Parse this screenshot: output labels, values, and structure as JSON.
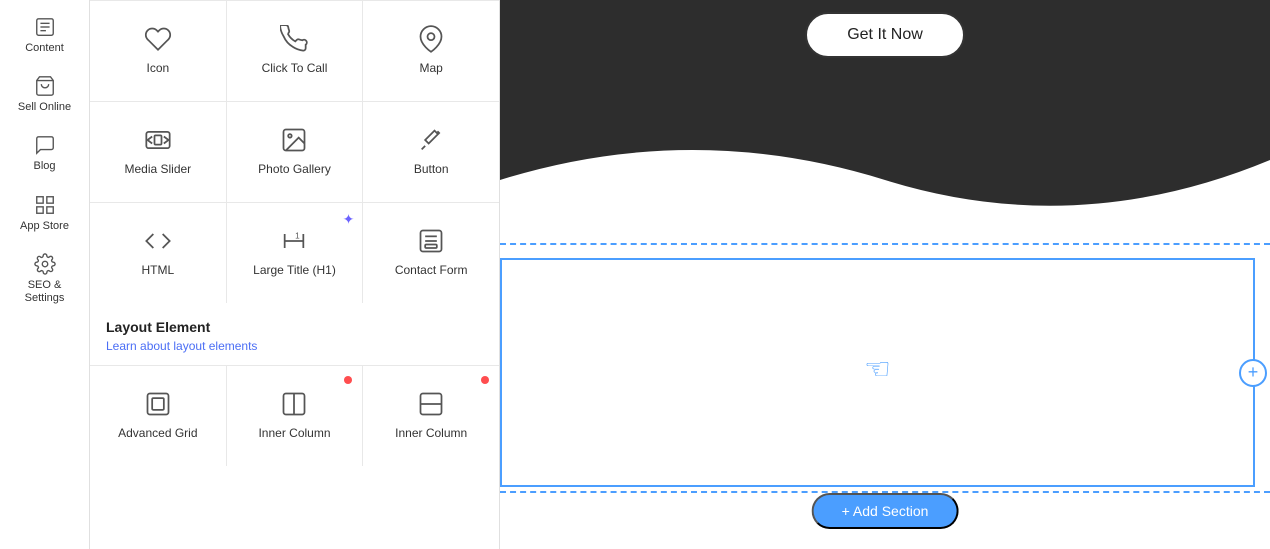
{
  "sidebar": {
    "items": [
      {
        "id": "content",
        "label": "Content",
        "icon": "content"
      },
      {
        "id": "sell-online",
        "label": "Sell Online",
        "icon": "cart"
      },
      {
        "id": "blog",
        "label": "Blog",
        "icon": "chat"
      },
      {
        "id": "app-store",
        "label": "App Store",
        "icon": "grid"
      },
      {
        "id": "seo-settings",
        "label": "SEO & Settings",
        "icon": "gear"
      }
    ]
  },
  "panel": {
    "widgets": [
      {
        "id": "icon",
        "label": "Icon",
        "icon": "heart",
        "badge": null
      },
      {
        "id": "click-to-call",
        "label": "Click To Call",
        "icon": "phone",
        "badge": null
      },
      {
        "id": "map",
        "label": "Map",
        "icon": "map-pin",
        "badge": null
      },
      {
        "id": "media-slider",
        "label": "Media Slider",
        "icon": "media-slider",
        "badge": null
      },
      {
        "id": "photo-gallery",
        "label": "Photo Gallery",
        "icon": "photo-gallery",
        "badge": null
      },
      {
        "id": "button",
        "label": "Button",
        "icon": "button",
        "badge": null
      },
      {
        "id": "html",
        "label": "HTML",
        "icon": "code",
        "badge": null
      },
      {
        "id": "large-title",
        "label": "Large Title (H1)",
        "icon": "h1",
        "badge": "star"
      },
      {
        "id": "contact-form",
        "label": "Contact Form",
        "icon": "form",
        "badge": null
      }
    ],
    "layout_section": {
      "title": "Layout Element",
      "learn_link": "Learn about layout elements",
      "items": [
        {
          "id": "advanced-grid",
          "label": "Advanced Grid",
          "icon": "advanced-grid",
          "badge": null
        },
        {
          "id": "inner-column-1",
          "label": "Inner Column",
          "icon": "inner-column",
          "badge": "dot"
        },
        {
          "id": "inner-column-2",
          "label": "Inner Column",
          "icon": "inner-column-v",
          "badge": "dot"
        }
      ]
    }
  },
  "canvas": {
    "get_it_now_label": "+ Add Section",
    "hero_button_label": "Get It Now",
    "add_section_label": "+ Add Section",
    "plus_icon": "+"
  }
}
